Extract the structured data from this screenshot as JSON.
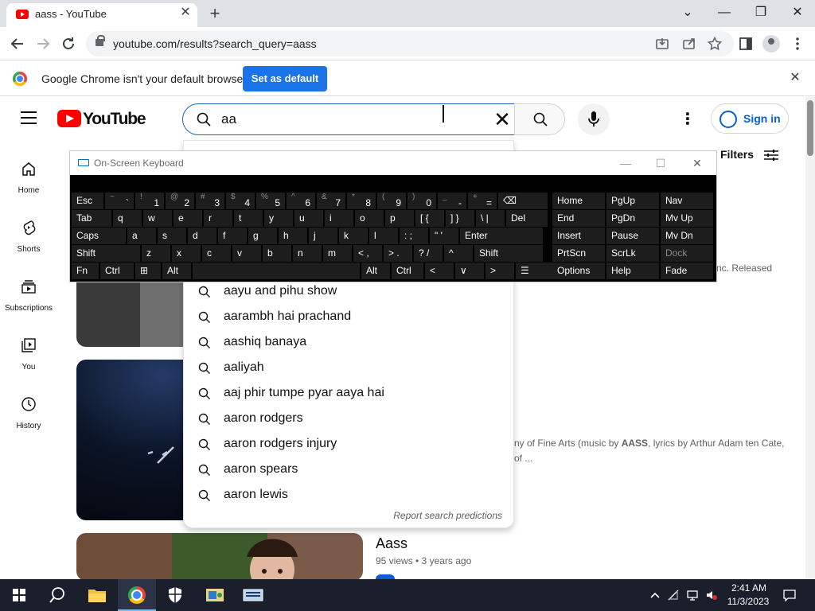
{
  "browser": {
    "tab_title": "aass - YouTube",
    "tab_close": "✕",
    "new_tab": "+",
    "url": "youtube.com/results?search_query=aass",
    "window_controls": {
      "minimize": "—",
      "restore": "❐",
      "close": "✕",
      "tab_search": "⌄"
    }
  },
  "infobar": {
    "message": "Google Chrome isn't your default browser",
    "button": "Set as default",
    "close": "✕"
  },
  "youtube": {
    "wordmark": "YouTube",
    "search_value": "aa",
    "search_clear": "✕",
    "sign_in": "Sign in",
    "more": "⋮",
    "filters": "Filters",
    "guide": [
      {
        "label": "Home"
      },
      {
        "label": "Shorts"
      },
      {
        "label": "Subscriptions"
      },
      {
        "label": "You"
      },
      {
        "label": "History"
      }
    ],
    "suggestions": [
      "aayu and pihu show",
      "aarambh hai prachand",
      "aashiq banaya",
      "aaliyah",
      "aaj phir tumpe pyar aaya hai",
      "aaron rodgers",
      "aaron rodgers injury",
      "aaron spears",
      "aaron lewis"
    ],
    "report_predictions": "Report search predictions",
    "results": {
      "r1_meta": "nc. Released",
      "r2_desc_line1_a": "ny of Fine Arts (music by ",
      "r2_desc_line1_b": "AASS",
      "r2_desc_line1_c": ", lyrics by Arthur Adam ten Cate,",
      "r2_desc_line2": "of ...",
      "r3_title": "Aass",
      "r3_meta": "95 views • 3 years ago"
    }
  },
  "osk": {
    "title": "On-Screen Keyboard",
    "controls": {
      "minimize": "—",
      "maximize": "☐",
      "close": "✕"
    },
    "row1": [
      {
        "main": "Esc"
      },
      {
        "sec": "~",
        "pri": "`"
      },
      {
        "sec": "!",
        "pri": "1"
      },
      {
        "sec": "@",
        "pri": "2"
      },
      {
        "sec": "#",
        "pri": "3"
      },
      {
        "sec": "$",
        "pri": "4"
      },
      {
        "sec": "%",
        "pri": "5"
      },
      {
        "sec": "^",
        "pri": "6"
      },
      {
        "sec": "&",
        "pri": "7"
      },
      {
        "sec": "*",
        "pri": "8"
      },
      {
        "sec": "(",
        "pri": "9"
      },
      {
        "sec": ")",
        "pri": "0"
      },
      {
        "sec": "_",
        "pri": "-"
      },
      {
        "sec": "+",
        "pri": "="
      },
      {
        "main": "⌫"
      }
    ],
    "row2": [
      "Tab",
      "q",
      "w",
      "e",
      "r",
      "t",
      "y",
      "u",
      "i",
      "o",
      "p",
      "[ {",
      "] }",
      "\\ |",
      "Del"
    ],
    "row3": [
      "Caps",
      "a",
      "s",
      "d",
      "f",
      "g",
      "h",
      "j",
      "k",
      "l",
      ": ;",
      "\" '",
      "Enter"
    ],
    "row4": [
      "Shift",
      "z",
      "x",
      "c",
      "v",
      "b",
      "n",
      "m",
      "< ,",
      "> .",
      "? /",
      "^",
      "Shift"
    ],
    "row5": [
      "Fn",
      "Ctrl",
      "⊞",
      "Alt",
      "",
      "Alt",
      "Ctrl",
      "<",
      "∨",
      ">",
      "☰"
    ],
    "nav_col1": [
      "Home",
      "End",
      "Insert",
      "PrtScn",
      "Options"
    ],
    "nav_col2": [
      "PgUp",
      "PgDn",
      "Pause",
      "ScrLk",
      "Help"
    ],
    "nav_col3": [
      "Nav",
      "Mv Up",
      "Mv Dn",
      "Dock",
      "Fade"
    ]
  },
  "taskbar": {
    "time": "2:41 AM",
    "date": "11/3/2023"
  },
  "colors": {
    "youtube_red": "#ff0000",
    "link_blue": "#065fd4",
    "chrome_blue": "#1a73e8",
    "taskbar": "#1b1e2b"
  }
}
